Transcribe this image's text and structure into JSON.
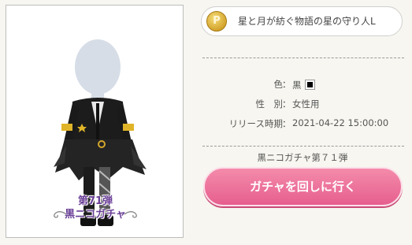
{
  "item": {
    "name": "星と月が紡ぐ物語の星の守り人L",
    "coin_symbol": "P",
    "caption_line1": "第71弾",
    "caption_line2": "黒ニコガチャ"
  },
  "details": {
    "color_label": "色",
    "color_value": "黒",
    "color_swatch_hex": "#000000",
    "gender_label": "性　別",
    "gender_value": "女性用",
    "release_label": "リリース時期",
    "release_value": "2021-04-22 15:00:00",
    "colon": "："
  },
  "gacha": {
    "name": "黒ニコガチャ第７１弾",
    "button_label": "ガチャを回しに行く"
  }
}
